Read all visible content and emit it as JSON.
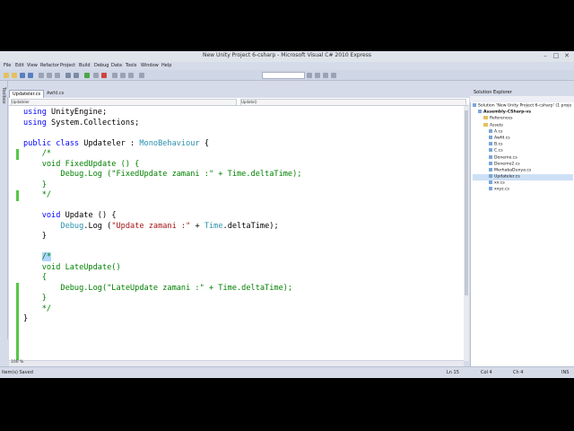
{
  "window": {
    "title": "New Unity Project 6-csharp - Microsoft Visual C# 2010 Express",
    "controls": [
      "–",
      "□",
      "✕"
    ]
  },
  "menu": [
    "File",
    "Edit",
    "View",
    "Refactor",
    "Project",
    "Build",
    "Debug",
    "Data",
    "Tools",
    "Window",
    "Help"
  ],
  "lefttool": {
    "label": "Toolbox"
  },
  "tabs": [
    {
      "label": "Updateler.cs",
      "active": true
    },
    {
      "label": "Awfd.cs",
      "active": false
    }
  ],
  "navbar": {
    "left": "Updateler",
    "right": "Update()"
  },
  "code": {
    "lines": [
      [
        {
          "t": "using",
          "c": "kw"
        },
        {
          "t": " UnityEngine;"
        }
      ],
      [
        {
          "t": "using",
          "c": "kw"
        },
        {
          "t": " System.Collections;"
        }
      ],
      [
        {
          "t": ""
        }
      ],
      [
        {
          "t": "public",
          "c": "kw"
        },
        {
          "t": " "
        },
        {
          "t": "class",
          "c": "kw"
        },
        {
          "t": " Updateler : "
        },
        {
          "t": "MonoBehaviour",
          "c": "ty"
        },
        {
          "t": " {"
        }
      ],
      [
        {
          "t": "    /*",
          "c": "cm"
        }
      ],
      [
        {
          "t": "    void FixedUpdate () {",
          "c": "cm"
        }
      ],
      [
        {
          "t": "        Debug.Log (\"FixedUpdate zamani :\" + Time.deltaTime);",
          "c": "cm"
        }
      ],
      [
        {
          "t": "    }",
          "c": "cm"
        }
      ],
      [
        {
          "t": "    */",
          "c": "cm"
        }
      ],
      [
        {
          "t": ""
        }
      ],
      [
        {
          "t": "    "
        },
        {
          "t": "void",
          "c": "kw"
        },
        {
          "t": " Update () {"
        }
      ],
      [
        {
          "t": "        "
        },
        {
          "t": "Debug",
          "c": "ty"
        },
        {
          "t": ".Log ("
        },
        {
          "t": "\"Update zamani :\"",
          "c": "str"
        },
        {
          "t": " + "
        },
        {
          "t": "Time",
          "c": "ty"
        },
        {
          "t": ".deltaTime);"
        }
      ],
      [
        {
          "t": "    }"
        }
      ],
      [
        {
          "t": ""
        }
      ],
      [
        {
          "t": "    "
        },
        {
          "t": "/*",
          "c": "cm hl"
        }
      ],
      [
        {
          "t": "    void LateUpdate()",
          "c": "cm"
        }
      ],
      [
        {
          "t": "    {",
          "c": "cm"
        }
      ],
      [
        {
          "t": "        Debug.Log(\"LateUpdate zamani :\" + Time.deltaTime);",
          "c": "cm"
        }
      ],
      [
        {
          "t": "    }",
          "c": "cm"
        }
      ],
      [
        {
          "t": "    */",
          "c": "cm"
        }
      ],
      [
        {
          "t": "}"
        }
      ]
    ]
  },
  "zoom": "100 %",
  "solution_explorer": {
    "title": "Solution Explorer",
    "items": [
      {
        "label": "Solution 'New Unity Project 6-csharp' (1 proje",
        "icon": "solution",
        "level": 0
      },
      {
        "label": "Assembly-CSharp-vs",
        "icon": "project",
        "level": 1,
        "bold": true
      },
      {
        "label": "References",
        "icon": "folder",
        "level": 2
      },
      {
        "label": "Assets",
        "icon": "folder",
        "level": 2
      },
      {
        "label": "A.cs",
        "icon": "file",
        "level": 3
      },
      {
        "label": "Awfd.cs",
        "icon": "file",
        "level": 3
      },
      {
        "label": "B.cs",
        "icon": "file",
        "level": 3
      },
      {
        "label": "C.cs",
        "icon": "file",
        "level": 3
      },
      {
        "label": "Deneme.cs",
        "icon": "file",
        "level": 3
      },
      {
        "label": "Deneme2.cs",
        "icon": "file",
        "level": 3
      },
      {
        "label": "MerhabaDunya.cs",
        "icon": "file",
        "level": 3
      },
      {
        "label": "Updateler.cs",
        "icon": "file",
        "level": 3,
        "selected": true
      },
      {
        "label": "xx.cs",
        "icon": "file",
        "level": 3
      },
      {
        "label": "xxyz.cs",
        "icon": "file",
        "level": 3
      }
    ]
  },
  "status": {
    "message": "Item(s) Saved",
    "line": "Ln 15",
    "col": "Col 4",
    "ch": "Ch 4",
    "mode": "INS"
  }
}
